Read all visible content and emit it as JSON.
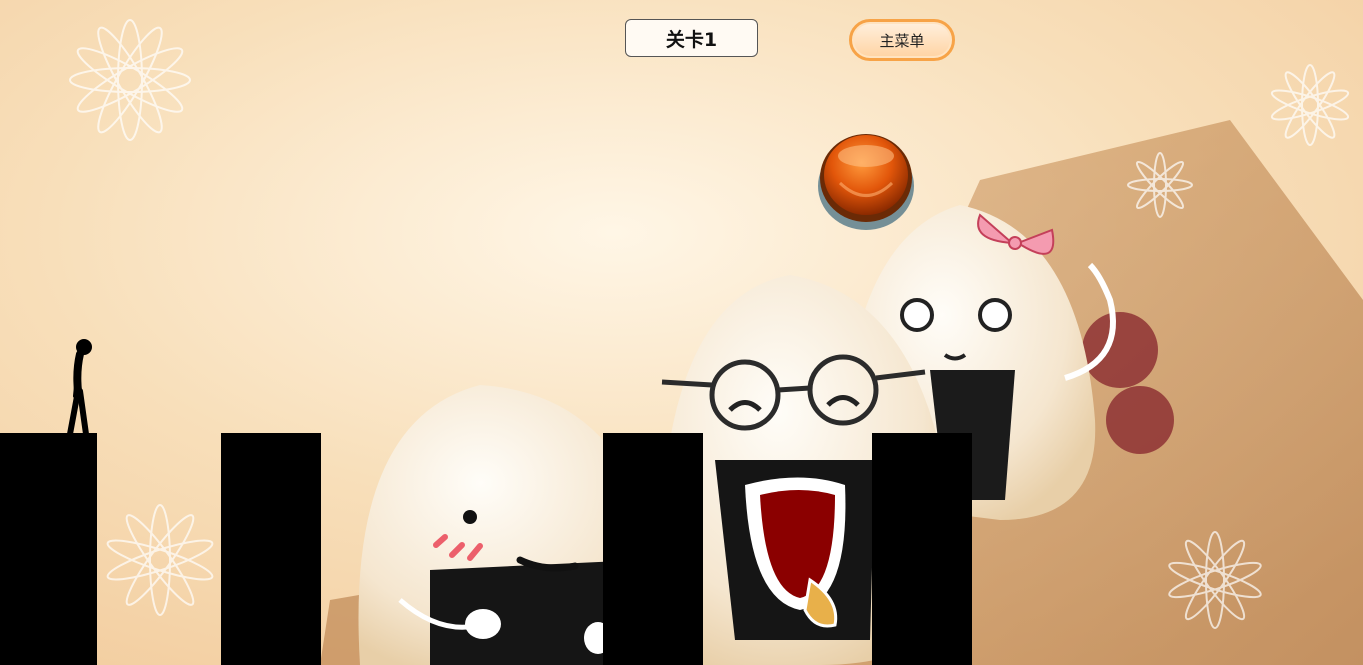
{
  "level": {
    "label": "关卡1"
  },
  "menu": {
    "main_menu_label": "主菜单"
  },
  "colors": {
    "pillar": "#000000",
    "menu_border": "#f7a347",
    "orb": "#e2560a"
  },
  "scene": {
    "background": "rice-ball-characters",
    "pillar_count": 4,
    "player": "stick-figure",
    "button": "orange-round-button"
  }
}
